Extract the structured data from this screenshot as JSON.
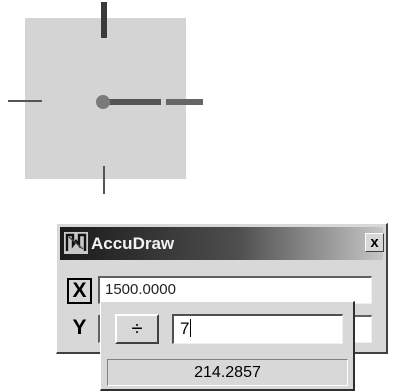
{
  "window": {
    "title": "AccuDraw",
    "close_glyph": "x"
  },
  "fields": {
    "x_label": "X",
    "x_value": "1500.0000",
    "y_label": "Y",
    "y_value": ""
  },
  "calculator": {
    "operator": "÷",
    "input": "7",
    "result": "214.2857"
  },
  "icons": [
    "compass-icon",
    "accudraw-app-icon",
    "close-icon",
    "divide-icon"
  ]
}
